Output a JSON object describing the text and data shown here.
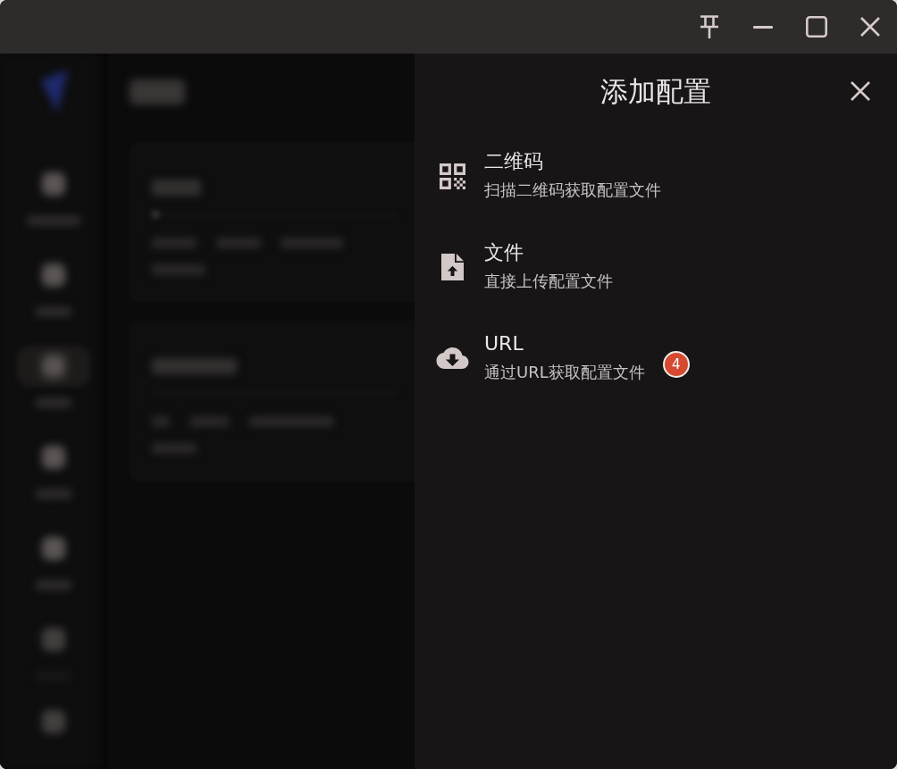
{
  "drawer": {
    "title": "添加配置",
    "options": [
      {
        "title": "二维码",
        "description": "扫描二维码获取配置文件"
      },
      {
        "title": "文件",
        "description": "直接上传配置文件"
      },
      {
        "title": "URL",
        "description": "通过URL获取配置文件",
        "badge": "4"
      }
    ]
  }
}
